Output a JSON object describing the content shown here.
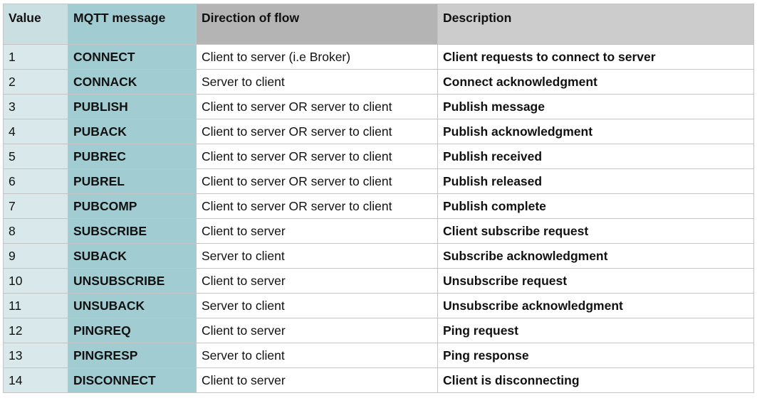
{
  "table": {
    "headers": [
      "Value",
      "MQTT message",
      "Direction of flow",
      "Description"
    ],
    "rows": [
      [
        "1",
        "CONNECT",
        "Client to server (i.e Broker)",
        "Client requests to connect to server"
      ],
      [
        "2",
        "CONNACK",
        "Server to client",
        "Connect acknowledgment"
      ],
      [
        "3",
        "PUBLISH",
        "Client to server OR server to client",
        "Publish message"
      ],
      [
        "4",
        "PUBACK",
        "Client to server OR server to client",
        "Publish acknowledgment"
      ],
      [
        "5",
        "PUBREC",
        "Client to server OR server to client",
        "Publish received"
      ],
      [
        "6",
        "PUBREL",
        "Client to server OR server to client",
        "Publish released"
      ],
      [
        "7",
        "PUBCOMP",
        "Client to server OR server to client",
        "Publish complete"
      ],
      [
        "8",
        "SUBSCRIBE",
        "Client to server",
        "Client subscribe request"
      ],
      [
        "9",
        "SUBACK",
        "Server to client",
        "Subscribe acknowledgment"
      ],
      [
        "10",
        "UNSUBSCRIBE",
        "Client to server",
        "Unsubscribe request"
      ],
      [
        "11",
        "UNSUBACK",
        "Server to client",
        "Unsubscribe acknowledgment"
      ],
      [
        "12",
        "PINGREQ",
        "Client to server",
        "Ping request"
      ],
      [
        "13",
        "PINGRESP",
        "Server to client",
        "Ping response"
      ],
      [
        "14",
        "DISCONNECT",
        "Client to server",
        "Client is disconnecting"
      ]
    ]
  },
  "colors": {
    "header_value_bg": "#c9dfe2",
    "header_message_bg": "#a1cdd2",
    "header_direction_bg": "#b4b4b4",
    "header_description_bg": "#cccccc",
    "value_column_bg": "#d9e8ea",
    "message_column_bg": "#a1cdd2",
    "border": "#c4c4c4"
  }
}
